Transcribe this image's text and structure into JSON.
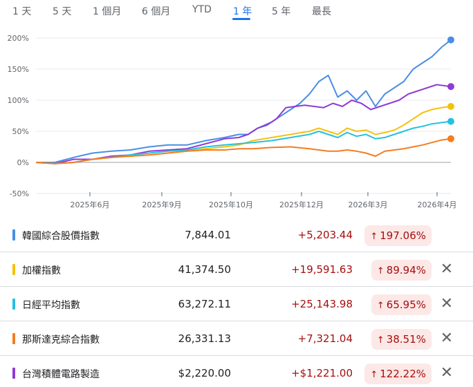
{
  "tabs": [
    {
      "label": "1 天",
      "active": false
    },
    {
      "label": "5 天",
      "active": false
    },
    {
      "label": "1 個月",
      "active": false
    },
    {
      "label": "6 個月",
      "active": false
    },
    {
      "label": "YTD",
      "active": false
    },
    {
      "label": "1 年",
      "active": true
    },
    {
      "label": "5 年",
      "active": false
    },
    {
      "label": "最長",
      "active": false
    }
  ],
  "chart_data": {
    "type": "line",
    "y_ticks": [
      "200%",
      "150%",
      "100%",
      "50%",
      "0%",
      "-50%"
    ],
    "ylim": [
      -50,
      200
    ],
    "x_ticks": [
      "2025年6月",
      "2025年9月",
      "2025年10月",
      "2025年12月",
      "2026年3月",
      "2026年4月"
    ],
    "series": [
      {
        "color": "#4a8ee4",
        "points": [
          [
            0,
            0
          ],
          [
            20,
            0
          ],
          [
            40,
            8
          ],
          [
            60,
            15
          ],
          [
            80,
            18
          ],
          [
            100,
            20
          ],
          [
            120,
            25
          ],
          [
            140,
            28
          ],
          [
            160,
            28
          ],
          [
            180,
            35
          ],
          [
            200,
            40
          ],
          [
            215,
            45
          ],
          [
            225,
            45
          ],
          [
            235,
            55
          ],
          [
            250,
            65
          ],
          [
            260,
            75
          ],
          [
            270,
            85
          ],
          [
            280,
            95
          ],
          [
            290,
            110
          ],
          [
            300,
            130
          ],
          [
            310,
            140
          ],
          [
            320,
            105
          ],
          [
            330,
            115
          ],
          [
            340,
            100
          ],
          [
            350,
            115
          ],
          [
            360,
            90
          ],
          [
            370,
            110
          ],
          [
            380,
            120
          ],
          [
            390,
            130
          ],
          [
            400,
            150
          ],
          [
            410,
            160
          ],
          [
            420,
            170
          ],
          [
            430,
            185
          ],
          [
            440,
            197
          ]
        ]
      },
      {
        "color": "#8f3bd6",
        "points": [
          [
            0,
            0
          ],
          [
            20,
            -2
          ],
          [
            40,
            5
          ],
          [
            60,
            5
          ],
          [
            80,
            10
          ],
          [
            100,
            12
          ],
          [
            120,
            18
          ],
          [
            140,
            20
          ],
          [
            160,
            22
          ],
          [
            180,
            30
          ],
          [
            200,
            38
          ],
          [
            215,
            40
          ],
          [
            225,
            45
          ],
          [
            235,
            55
          ],
          [
            245,
            60
          ],
          [
            255,
            70
          ],
          [
            265,
            88
          ],
          [
            275,
            90
          ],
          [
            285,
            92
          ],
          [
            295,
            90
          ],
          [
            305,
            88
          ],
          [
            315,
            95
          ],
          [
            325,
            90
          ],
          [
            335,
            100
          ],
          [
            345,
            95
          ],
          [
            355,
            85
          ],
          [
            365,
            90
          ],
          [
            375,
            95
          ],
          [
            385,
            100
          ],
          [
            395,
            110
          ],
          [
            405,
            115
          ],
          [
            415,
            120
          ],
          [
            425,
            125
          ],
          [
            440,
            122
          ]
        ]
      },
      {
        "color": "#f4c20d",
        "points": [
          [
            0,
            0
          ],
          [
            20,
            -2
          ],
          [
            40,
            0
          ],
          [
            60,
            5
          ],
          [
            80,
            8
          ],
          [
            100,
            10
          ],
          [
            120,
            12
          ],
          [
            140,
            15
          ],
          [
            160,
            18
          ],
          [
            180,
            22
          ],
          [
            200,
            25
          ],
          [
            215,
            28
          ],
          [
            230,
            35
          ],
          [
            250,
            40
          ],
          [
            270,
            45
          ],
          [
            290,
            50
          ],
          [
            300,
            55
          ],
          [
            310,
            50
          ],
          [
            320,
            45
          ],
          [
            330,
            55
          ],
          [
            340,
            50
          ],
          [
            350,
            52
          ],
          [
            360,
            45
          ],
          [
            370,
            48
          ],
          [
            380,
            52
          ],
          [
            390,
            60
          ],
          [
            400,
            70
          ],
          [
            410,
            80
          ],
          [
            420,
            85
          ],
          [
            430,
            88
          ],
          [
            440,
            90
          ]
        ]
      },
      {
        "color": "#24c1e0",
        "points": [
          [
            0,
            0
          ],
          [
            20,
            -2
          ],
          [
            40,
            0
          ],
          [
            60,
            5
          ],
          [
            80,
            8
          ],
          [
            100,
            12
          ],
          [
            120,
            15
          ],
          [
            140,
            18
          ],
          [
            160,
            20
          ],
          [
            180,
            25
          ],
          [
            200,
            28
          ],
          [
            215,
            30
          ],
          [
            230,
            32
          ],
          [
            250,
            35
          ],
          [
            270,
            40
          ],
          [
            290,
            45
          ],
          [
            300,
            50
          ],
          [
            310,
            45
          ],
          [
            320,
            40
          ],
          [
            330,
            48
          ],
          [
            340,
            42
          ],
          [
            350,
            45
          ],
          [
            360,
            38
          ],
          [
            370,
            40
          ],
          [
            380,
            45
          ],
          [
            390,
            50
          ],
          [
            400,
            55
          ],
          [
            410,
            58
          ],
          [
            420,
            62
          ],
          [
            430,
            64
          ],
          [
            440,
            66
          ]
        ]
      },
      {
        "color": "#f57c1f",
        "points": [
          [
            0,
            0
          ],
          [
            20,
            -2
          ],
          [
            40,
            0
          ],
          [
            60,
            5
          ],
          [
            80,
            8
          ],
          [
            100,
            10
          ],
          [
            120,
            12
          ],
          [
            140,
            15
          ],
          [
            160,
            18
          ],
          [
            180,
            20
          ],
          [
            200,
            20
          ],
          [
            215,
            22
          ],
          [
            230,
            22
          ],
          [
            250,
            24
          ],
          [
            270,
            25
          ],
          [
            290,
            22
          ],
          [
            300,
            20
          ],
          [
            310,
            18
          ],
          [
            320,
            18
          ],
          [
            330,
            20
          ],
          [
            340,
            18
          ],
          [
            350,
            15
          ],
          [
            360,
            10
          ],
          [
            370,
            18
          ],
          [
            380,
            20
          ],
          [
            390,
            22
          ],
          [
            400,
            25
          ],
          [
            410,
            28
          ],
          [
            420,
            32
          ],
          [
            430,
            36
          ],
          [
            440,
            38
          ]
        ]
      }
    ]
  },
  "rows": [
    {
      "name": "韓國綜合股價指數",
      "price": "7,844.01",
      "change": "+5,203.44",
      "percent": "197.06%",
      "color": "#4a8ee4",
      "removable": false
    },
    {
      "name": "加權指數",
      "price": "41,374.50",
      "change": "+19,591.63",
      "percent": "89.94%",
      "color": "#f4c20d",
      "removable": true
    },
    {
      "name": "日經平均指數",
      "price": "63,272.11",
      "change": "+25,143.98",
      "percent": "65.95%",
      "color": "#24c1e0",
      "removable": true
    },
    {
      "name": "那斯達克綜合指數",
      "price": "26,331.13",
      "change": "+7,321.04",
      "percent": "38.51%",
      "color": "#f57c1f",
      "removable": true
    },
    {
      "name": "台灣積體電路製造",
      "price": "$2,220.00",
      "change": "+$1,221.00",
      "percent": "122.22%",
      "color": "#8f3bd6",
      "removable": true
    }
  ],
  "icons": {
    "up_arrow": "arrow-up-icon",
    "remove": "close-icon",
    "up_glyph": "↑",
    "close_glyph": "✕"
  }
}
